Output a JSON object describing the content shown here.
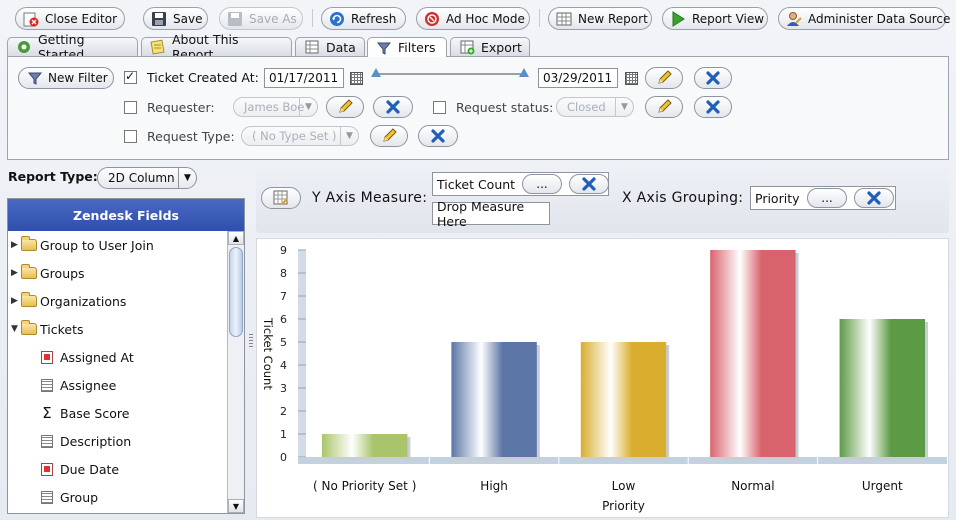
{
  "toolbar": {
    "close_editor": "Close Editor",
    "save": "Save",
    "save_as": "Save As",
    "refresh": "Refresh",
    "ad_hoc_mode": "Ad Hoc Mode",
    "new_report": "New Report",
    "report_view": "Report View",
    "administer_data_source": "Administer Data Source"
  },
  "tabs": [
    {
      "label": "Getting Started",
      "icon": "gear-icon"
    },
    {
      "label": "About This Report",
      "icon": "notepad-icon"
    },
    {
      "label": "Data",
      "icon": "table-icon"
    },
    {
      "label": "Filters",
      "icon": "funnel-icon",
      "active": true
    },
    {
      "label": "Export",
      "icon": "export-icon"
    }
  ],
  "filters": {
    "new_filter": "New Filter",
    "ticket_created": {
      "label": "Ticket Created At:",
      "checked": true,
      "from": "01/17/2011",
      "to": "03/29/2011"
    },
    "requester": {
      "label": "Requester:",
      "checked": false,
      "value": "James Boe"
    },
    "request_status": {
      "label": "Request status:",
      "checked": false,
      "value": "Closed"
    },
    "request_type": {
      "label": "Request Type:",
      "checked": false,
      "value": "( No Type Set )"
    }
  },
  "report_type": {
    "label": "Report Type:",
    "value": "2D Column"
  },
  "fields_panel": {
    "title": "Zendesk Fields",
    "items": [
      {
        "label": "Group to User Join",
        "kind": "folder",
        "expanded": false
      },
      {
        "label": "Groups",
        "kind": "folder",
        "expanded": false
      },
      {
        "label": "Organizations",
        "kind": "folder",
        "expanded": false
      },
      {
        "label": "Tickets",
        "kind": "folder",
        "expanded": true
      },
      {
        "label": "Assigned At",
        "kind": "date"
      },
      {
        "label": "Assignee",
        "kind": "text"
      },
      {
        "label": "Base Score",
        "kind": "measure"
      },
      {
        "label": "Description",
        "kind": "text"
      },
      {
        "label": "Due Date",
        "kind": "date"
      },
      {
        "label": "Group",
        "kind": "text"
      }
    ]
  },
  "measure_bar": {
    "y_axis_label": "Y Axis Measure:",
    "y_measure": "Ticket Count",
    "drop_measure": "Drop Measure Here",
    "x_axis_label": "X Axis Grouping:",
    "x_grouping": "Priority",
    "more": "..."
  },
  "chart_data": {
    "type": "bar",
    "categories": [
      "( No Priority Set )",
      "High",
      "Low",
      "Normal",
      "Urgent"
    ],
    "values": [
      1,
      5,
      5,
      9,
      6
    ],
    "colors": [
      "#a9c46a",
      "#5a75a6",
      "#d9ad2e",
      "#d9636c",
      "#5c9a45"
    ],
    "xlabel": "Priority",
    "ylabel": "Ticket Count",
    "ylim": [
      0,
      9
    ],
    "yticks": [
      0,
      1,
      2,
      3,
      4,
      5,
      6,
      7,
      8,
      9
    ]
  }
}
